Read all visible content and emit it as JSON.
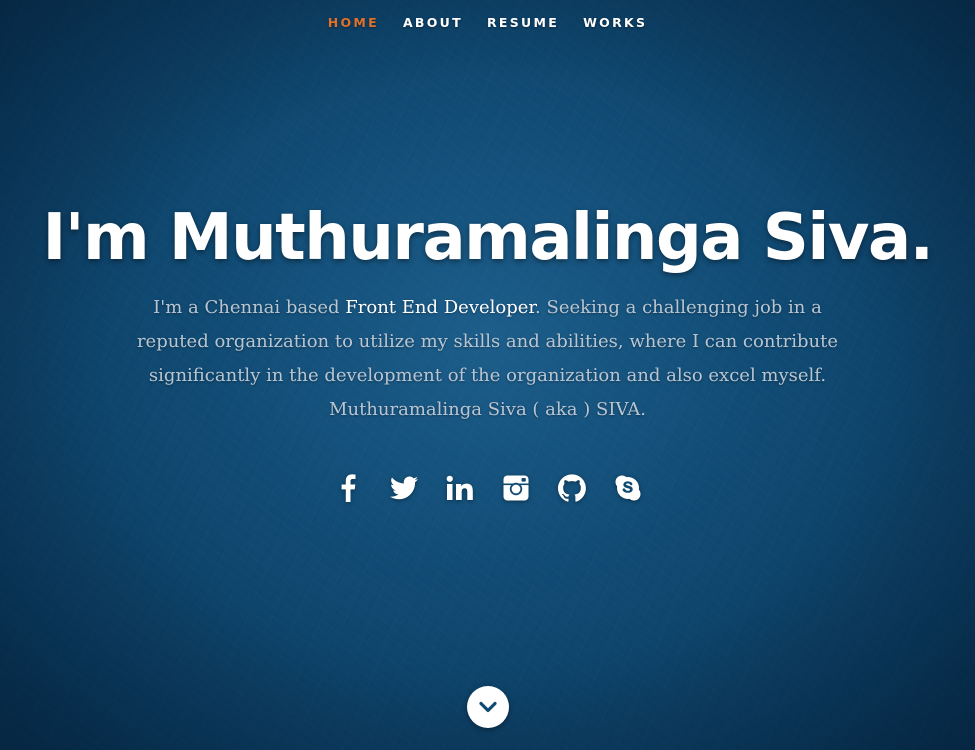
{
  "nav": {
    "items": [
      {
        "label": "HOME",
        "active": true
      },
      {
        "label": "ABOUT",
        "active": false
      },
      {
        "label": "RESUME",
        "active": false
      },
      {
        "label": "WORKS",
        "active": false
      }
    ],
    "active_color": "#e0712b"
  },
  "hero": {
    "title": "I'm Muthuramalinga Siva.",
    "intro_before": "I'm a Chennai based ",
    "intro_highlight": "Front End Developer",
    "intro_after": ". Seeking a challenging job in a reputed organization to utilize my skills and abilities, where I can contribute significantly in the development of the organization and also excel myself. Muthuramalinga Siva ( aka ) SIVA."
  },
  "social": {
    "icons": [
      "facebook-icon",
      "twitter-icon",
      "linkedin-icon",
      "instagram-icon",
      "github-icon",
      "skype-icon"
    ]
  },
  "scroll": {
    "icon": "chevron-down-icon"
  },
  "colors": {
    "background": "#0f4a72",
    "text": "#ffffff",
    "muted_text": "#b9c6d2"
  }
}
